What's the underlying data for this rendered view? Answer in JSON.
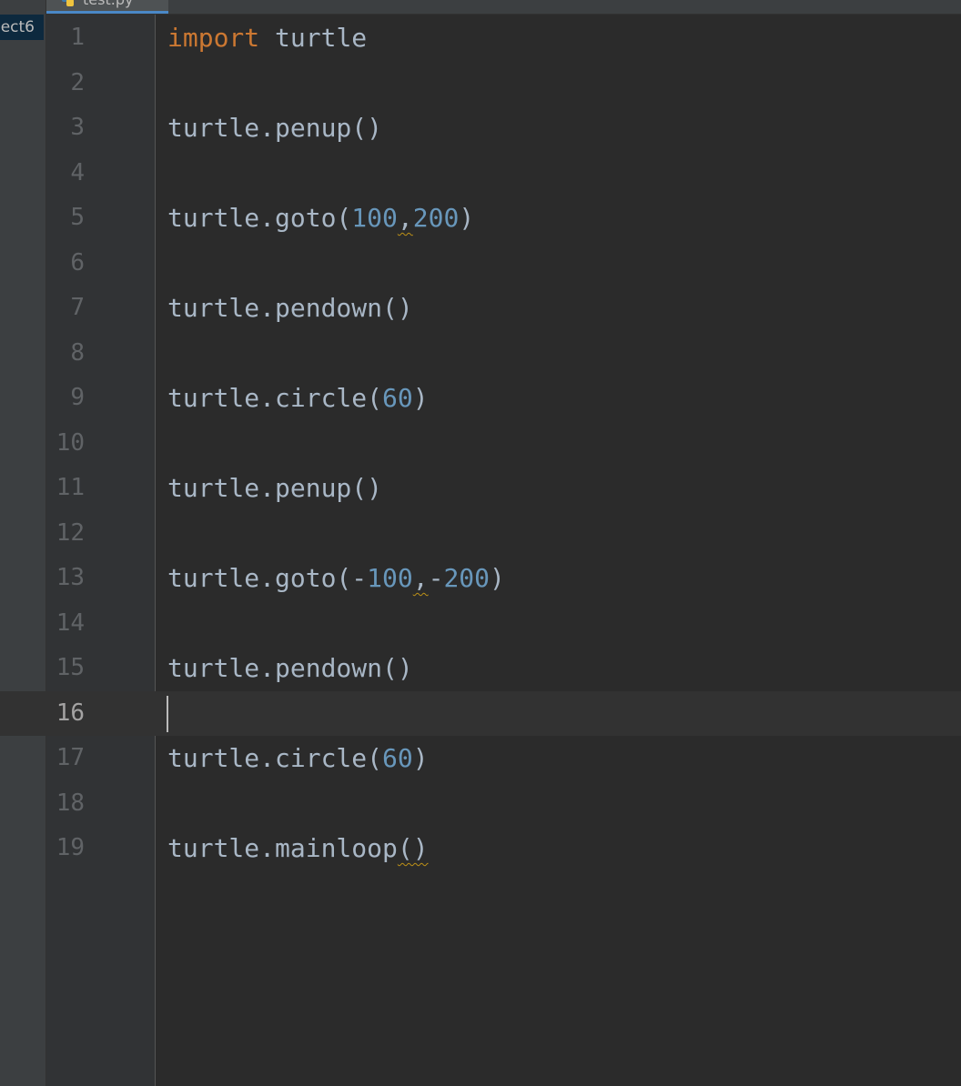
{
  "sidebar": {
    "project_label": "ect6"
  },
  "tab": {
    "label": "test.py",
    "icon": "python-file-icon"
  },
  "editor": {
    "current_line": 16,
    "lines": [
      {
        "num": "1",
        "tokens": [
          {
            "t": "import",
            "c": "kw"
          },
          {
            "t": " turtle",
            "c": ""
          }
        ]
      },
      {
        "num": "2",
        "tokens": []
      },
      {
        "num": "3",
        "tokens": [
          {
            "t": "turtle.penup()",
            "c": ""
          }
        ]
      },
      {
        "num": "4",
        "tokens": []
      },
      {
        "num": "5",
        "tokens": [
          {
            "t": "turtle.goto(",
            "c": ""
          },
          {
            "t": "100",
            "c": "num"
          },
          {
            "t": ",",
            "c": "warn"
          },
          {
            "t": "200",
            "c": "num"
          },
          {
            "t": ")",
            "c": ""
          }
        ]
      },
      {
        "num": "6",
        "tokens": []
      },
      {
        "num": "7",
        "tokens": [
          {
            "t": "turtle.pendown()",
            "c": ""
          }
        ]
      },
      {
        "num": "8",
        "tokens": []
      },
      {
        "num": "9",
        "tokens": [
          {
            "t": "turtle.circle(",
            "c": ""
          },
          {
            "t": "60",
            "c": "num"
          },
          {
            "t": ")",
            "c": ""
          }
        ]
      },
      {
        "num": "10",
        "tokens": []
      },
      {
        "num": "11",
        "tokens": [
          {
            "t": "turtle.penup()",
            "c": ""
          }
        ]
      },
      {
        "num": "12",
        "tokens": []
      },
      {
        "num": "13",
        "tokens": [
          {
            "t": "turtle.goto(-",
            "c": ""
          },
          {
            "t": "100",
            "c": "num"
          },
          {
            "t": ",",
            "c": "warn"
          },
          {
            "t": "-",
            "c": ""
          },
          {
            "t": "200",
            "c": "num"
          },
          {
            "t": ")",
            "c": ""
          }
        ]
      },
      {
        "num": "14",
        "tokens": []
      },
      {
        "num": "15",
        "tokens": [
          {
            "t": "turtle.pendown()",
            "c": ""
          }
        ]
      },
      {
        "num": "16",
        "tokens": []
      },
      {
        "num": "17",
        "tokens": [
          {
            "t": "turtle.circle(",
            "c": ""
          },
          {
            "t": "60",
            "c": "num"
          },
          {
            "t": ")",
            "c": ""
          }
        ]
      },
      {
        "num": "18",
        "tokens": []
      },
      {
        "num": "19",
        "tokens": [
          {
            "t": "turtle.mainloop",
            "c": ""
          },
          {
            "t": "()",
            "c": "warn"
          }
        ]
      }
    ]
  },
  "colors": {
    "background": "#2b2b2b",
    "gutter": "#313335",
    "keyword": "#cc7832",
    "number": "#6897bb",
    "text": "#a9b7c6",
    "current_line": "#323232",
    "tab_underline": "#4a88c7"
  }
}
